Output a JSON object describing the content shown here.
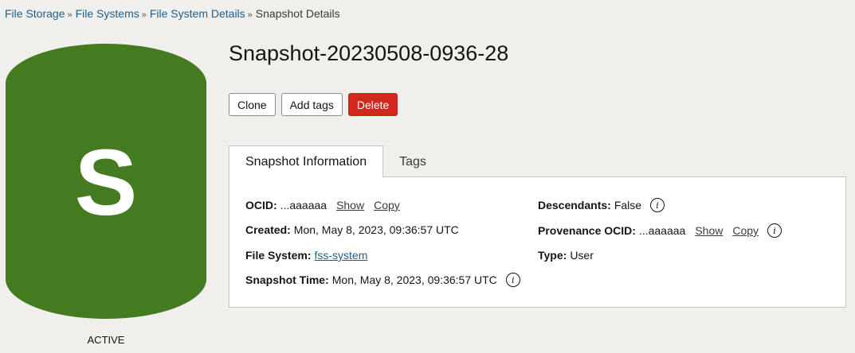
{
  "breadcrumb": {
    "items": [
      "File Storage",
      "File Systems",
      "File System Details"
    ],
    "current": "Snapshot Details",
    "separator": "»"
  },
  "resource_badge": {
    "letter": "S",
    "status": "ACTIVE",
    "color": "#447a20"
  },
  "page_title": "Snapshot-20230508-0936-28",
  "actions": {
    "clone": "Clone",
    "add_tags": "Add tags",
    "delete": "Delete"
  },
  "tabs": [
    {
      "label": "Snapshot Information",
      "active": true
    },
    {
      "label": "Tags",
      "active": false
    }
  ],
  "info": {
    "ocid": {
      "label": "OCID:",
      "value": "...aaaaaa",
      "show": "Show",
      "copy": "Copy"
    },
    "created": {
      "label": "Created:",
      "value": "Mon, May 8, 2023, 09:36:57 UTC"
    },
    "file_system": {
      "label": "File System:",
      "value": "fss-system"
    },
    "snapshot_time": {
      "label": "Snapshot Time:",
      "value": "Mon, May 8, 2023, 09:36:57 UTC"
    },
    "descendants": {
      "label": "Descendants:",
      "value": "False"
    },
    "provenance_ocid": {
      "label": "Provenance OCID:",
      "value": "...aaaaaa",
      "show": "Show",
      "copy": "Copy"
    },
    "type": {
      "label": "Type:",
      "value": "User"
    }
  },
  "icons": {
    "info": "info-icon",
    "info_glyph": "i"
  }
}
